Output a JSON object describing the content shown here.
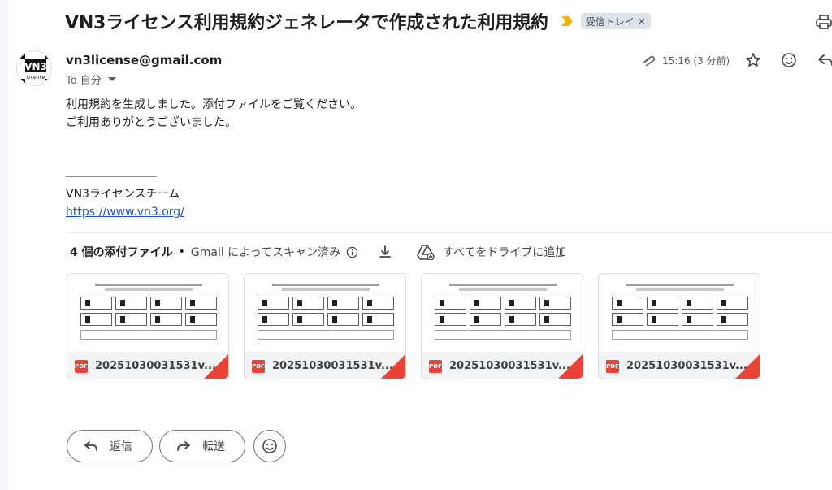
{
  "email": {
    "subject": "VN3ライセンス利用規約ジェネレータで作成された利用規約",
    "label": "受信トレイ",
    "label_remove": "×",
    "sender": "vn3license@gmail.com",
    "to": "To 自分",
    "avatar_text": "VN3",
    "avatar_sub": "License",
    "time": "15:16 (3 分前)",
    "body": {
      "line1": "利用規約を生成しました。添付ファイルをご覧ください。",
      "line2": "ご利用ありがとうございました。",
      "separator": "――――――――",
      "signature": "VN3ライセンスチーム",
      "link": "https://www.vn3.org/"
    }
  },
  "attachments": {
    "count_label": "4 個の添付ファイル",
    "dot": "•",
    "scan_label": "Gmail によってスキャン済み",
    "drive_label": "すべてをドライブに追加",
    "files": [
      {
        "name": "20251030031531v...",
        "type": "PDF"
      },
      {
        "name": "20251030031531v...",
        "type": "PDF"
      },
      {
        "name": "20251030031531v...",
        "type": "PDF"
      },
      {
        "name": "20251030031531v...",
        "type": "PDF"
      }
    ]
  },
  "actions": {
    "reply": "返信",
    "forward": "転送"
  },
  "colors": {
    "link": "#1a55c9",
    "pdf_red": "#ea4335",
    "chip_bg": "#dde3ea",
    "importance": "#f4b400"
  }
}
